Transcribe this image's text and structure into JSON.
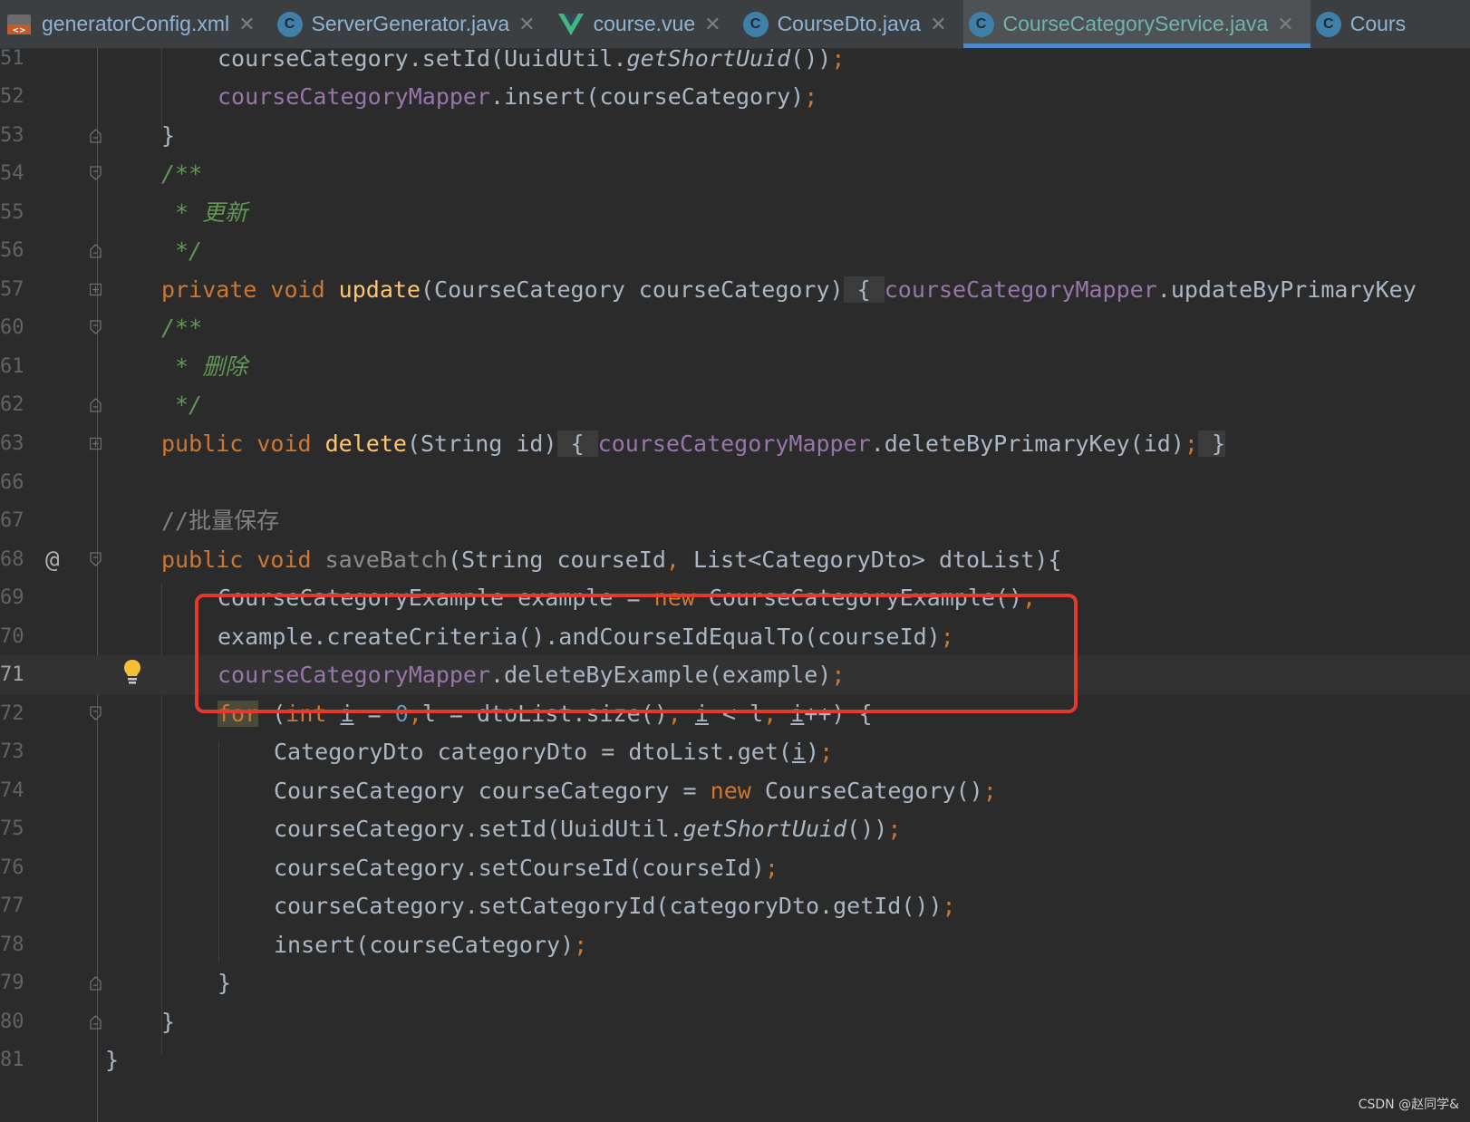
{
  "tabs": [
    {
      "label": "generatorConfig.xml",
      "icon": "xml-file-icon",
      "active": false
    },
    {
      "label": "ServerGenerator.java",
      "icon": "runnable-class-icon",
      "active": false
    },
    {
      "label": "course.vue",
      "icon": "vue-icon",
      "active": false
    },
    {
      "label": "CourseDto.java",
      "icon": "class-icon",
      "active": false
    },
    {
      "label": "CourseCategoryService.java",
      "icon": "class-icon",
      "active": true
    },
    {
      "label": "Cours",
      "icon": "class-icon",
      "active": false
    }
  ],
  "line_numbers": [
    "51",
    "52",
    "53",
    "54",
    "55",
    "56",
    "57",
    "60",
    "61",
    "62",
    "63",
    "66",
    "67",
    "68",
    "69",
    "70",
    "71",
    "72",
    "73",
    "74",
    "75",
    "76",
    "77",
    "78",
    "79",
    "80",
    "81"
  ],
  "comments": {
    "update": "* 更新",
    "delete": "* 删除",
    "batch": "//批量保存"
  },
  "watermark": "CSDN @赵同学&",
  "colors": {
    "background": "#2b2b2b",
    "keyword": "#cc7832",
    "method": "#ffc66d",
    "field": "#9876aa",
    "doc_comment": "#629755",
    "annotation_box": "#e5392c",
    "active_tab_underline": "#4a88c7"
  }
}
